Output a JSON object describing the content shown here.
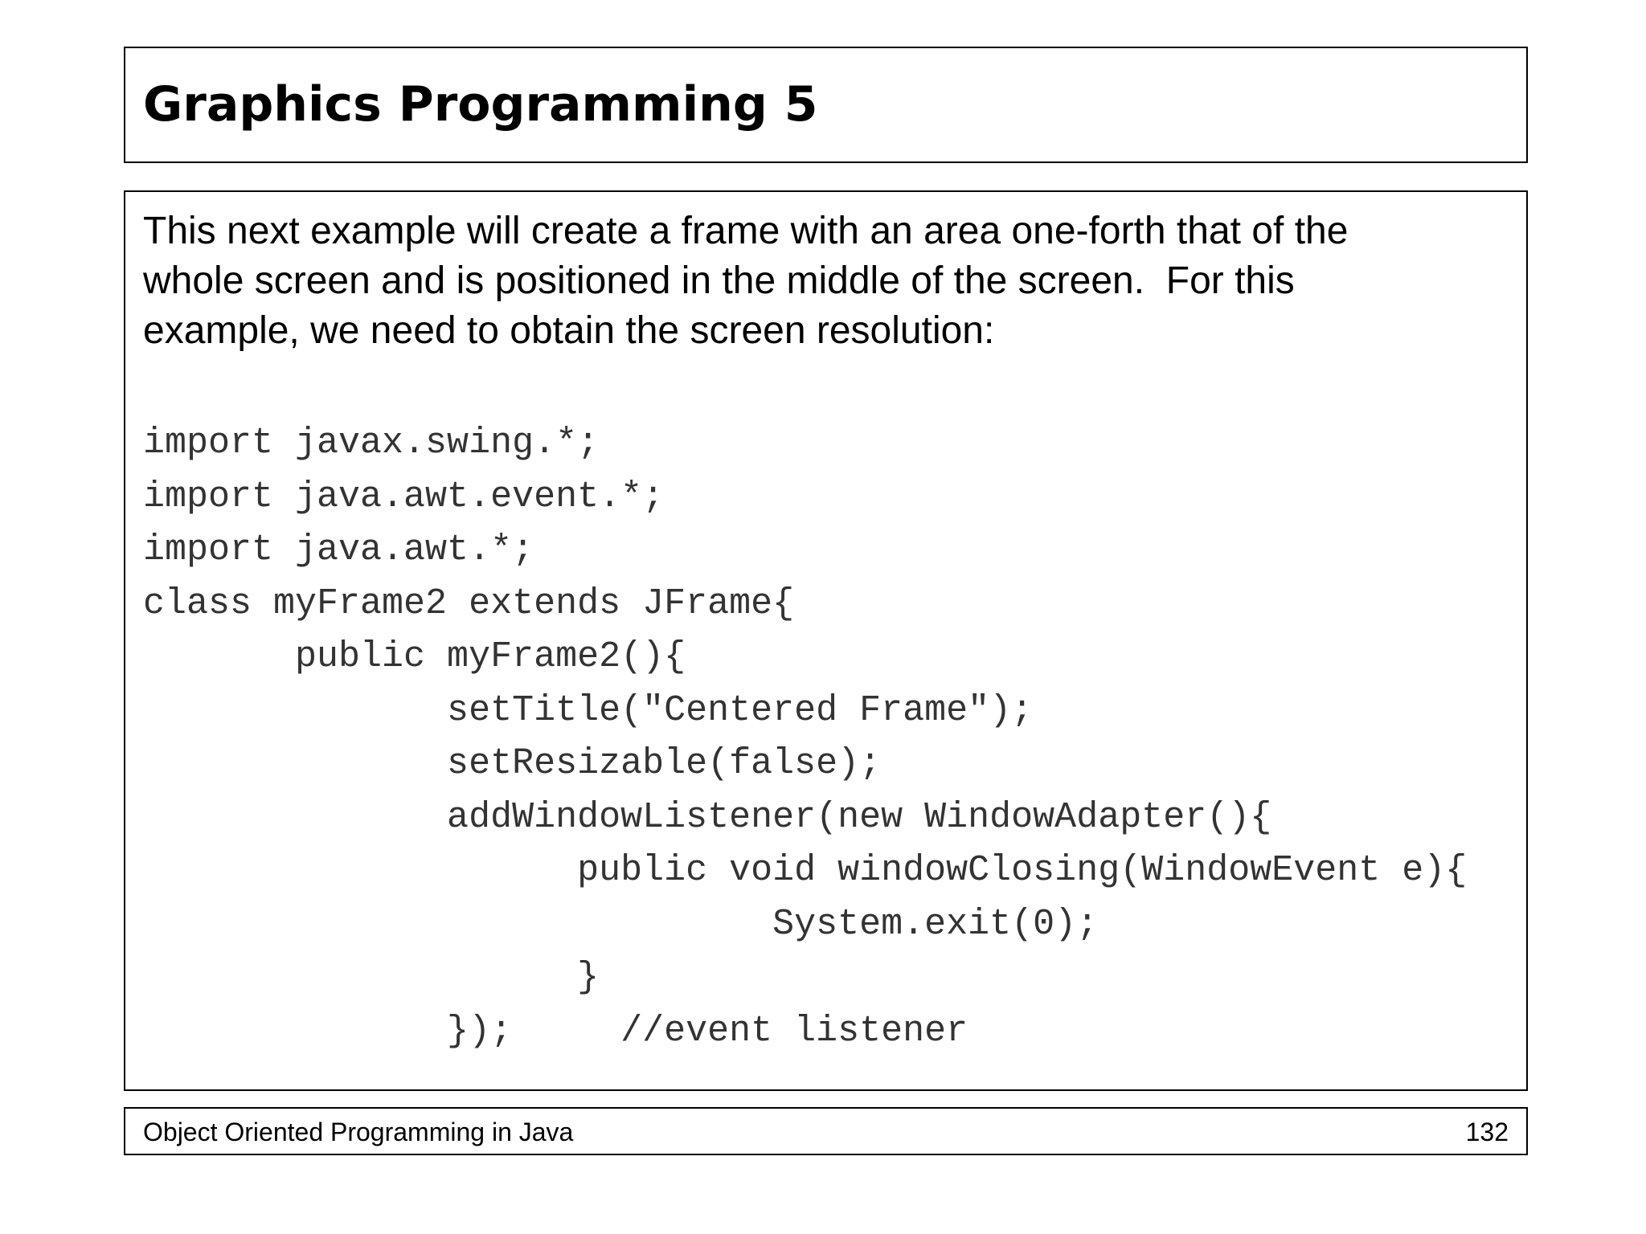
{
  "slide": {
    "title": "Graphics Programming 5",
    "intro_lines": [
      "This next example will create a frame with an area one-forth that of the",
      "whole screen and is positioned in the middle of the screen.  For this",
      "example, we need to obtain the screen resolution:"
    ],
    "code_lines": [
      "import javax.swing.*;",
      "import java.awt.event.*;",
      "import java.awt.*;",
      "class myFrame2 extends JFrame{",
      "       public myFrame2(){",
      "              setTitle(\"Centered Frame\");",
      "              setResizable(false);",
      "              addWindowListener(new WindowAdapter(){",
      "                    public void windowClosing(WindowEvent e){",
      "                             System.exit(0);",
      "                    }",
      "              });     //event listener"
    ]
  },
  "footer": {
    "course": "Object Oriented Programming in Java",
    "page_number": "132"
  }
}
